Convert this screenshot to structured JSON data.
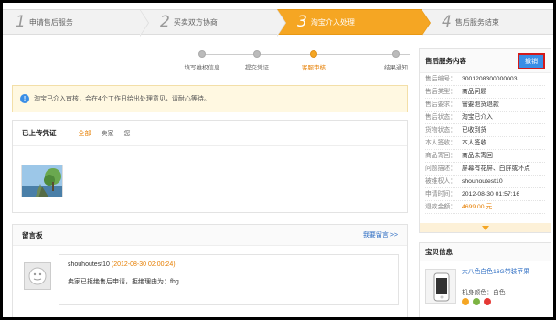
{
  "steps": [
    {
      "num": "1",
      "label": "申请售后服务",
      "active": false
    },
    {
      "num": "2",
      "label": "买卖双方协商",
      "active": false
    },
    {
      "num": "3",
      "label": "淘宝介入处理",
      "active": true
    },
    {
      "num": "4",
      "label": "售后服务结束",
      "active": false
    }
  ],
  "progress": {
    "nodes": [
      "填写维权信息",
      "提交凭证",
      "客服审核",
      "结果通知"
    ],
    "active_index": 2
  },
  "notice": {
    "text": "淘宝已介入审核，会在4个工作日给出处理意见，请耐心等待。"
  },
  "evidence": {
    "title": "已上传凭证",
    "tabs": [
      "全部",
      "卖家",
      "您"
    ],
    "active_tab": 0
  },
  "board": {
    "title": "留言板",
    "link": "我要留言 >>",
    "messages": [
      {
        "user": "shouhoutest10",
        "time": "(2012-08-30 02:00:24)",
        "text": "卖家已拒绝售后申请，拒绝理由为：fhg"
      }
    ]
  },
  "service": {
    "title": "售后服务内容",
    "button": "撤销",
    "rows": [
      {
        "k": "售后编号：",
        "v": "3001208300000003"
      },
      {
        "k": "售后类型：",
        "v": "商品问题"
      },
      {
        "k": "售后要求：",
        "v": "需要退货退款"
      },
      {
        "k": "售后状态：",
        "v": "淘宝已介入"
      },
      {
        "k": "货物状态：",
        "v": "已收到货"
      },
      {
        "k": "本人签收：",
        "v": "本人签收"
      },
      {
        "k": "商品寄回：",
        "v": "商品未寄回"
      },
      {
        "k": "问题描述：",
        "v": "屏幕有花屏、白屏或坏点"
      },
      {
        "k": "被维权人：",
        "v": "shouhoutest10"
      },
      {
        "k": "申请时间：",
        "v": "2012-08-30 01:57:16"
      },
      {
        "k": "退款金额：",
        "v": "4699.00 元"
      }
    ],
    "accent": "#f5a623"
  },
  "goods": {
    "title": "宝贝信息",
    "name": "大八色白色16G带装苹果",
    "color_label": "机身颜色：白色"
  }
}
